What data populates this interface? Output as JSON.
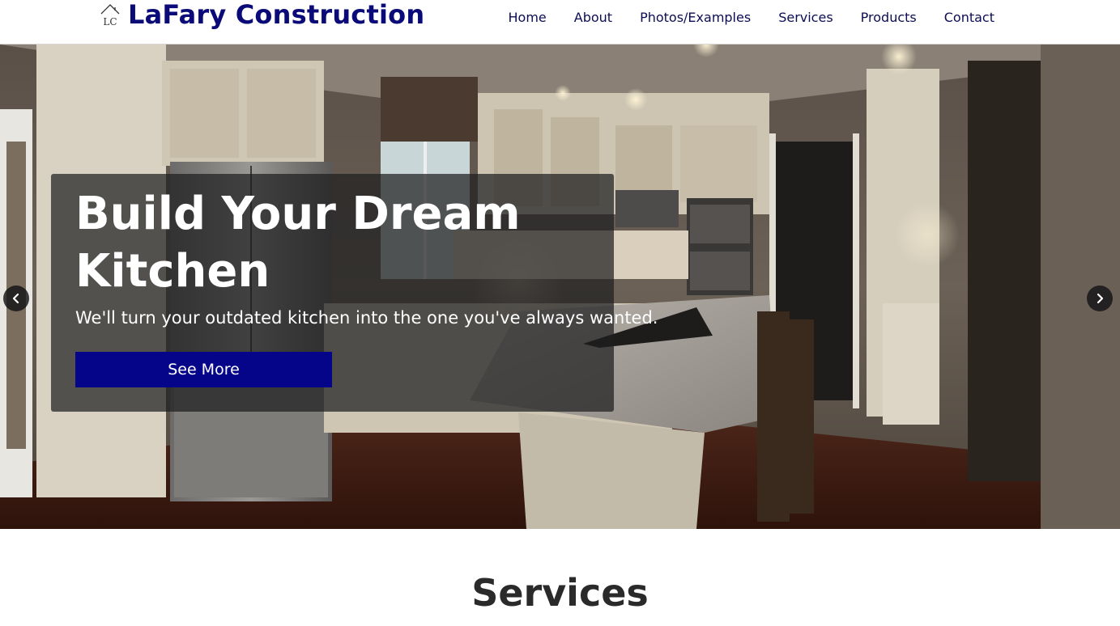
{
  "brand": {
    "logo_text": "LC",
    "name": "LaFary Construction",
    "color": "#0a0a78"
  },
  "nav": {
    "items": [
      {
        "label": "Home"
      },
      {
        "label": "About"
      },
      {
        "label": "Photos/Examples"
      },
      {
        "label": "Services"
      },
      {
        "label": "Products"
      },
      {
        "label": "Contact"
      }
    ]
  },
  "hero": {
    "title": "Build Your Dream Kitchen",
    "subtitle": "We'll turn your outdated kitchen into the one you've always wanted.",
    "button_label": "See More",
    "button_color": "#05058a",
    "prev_icon": "chevron-left-icon",
    "next_icon": "chevron-right-icon"
  },
  "services": {
    "heading": "Services"
  }
}
